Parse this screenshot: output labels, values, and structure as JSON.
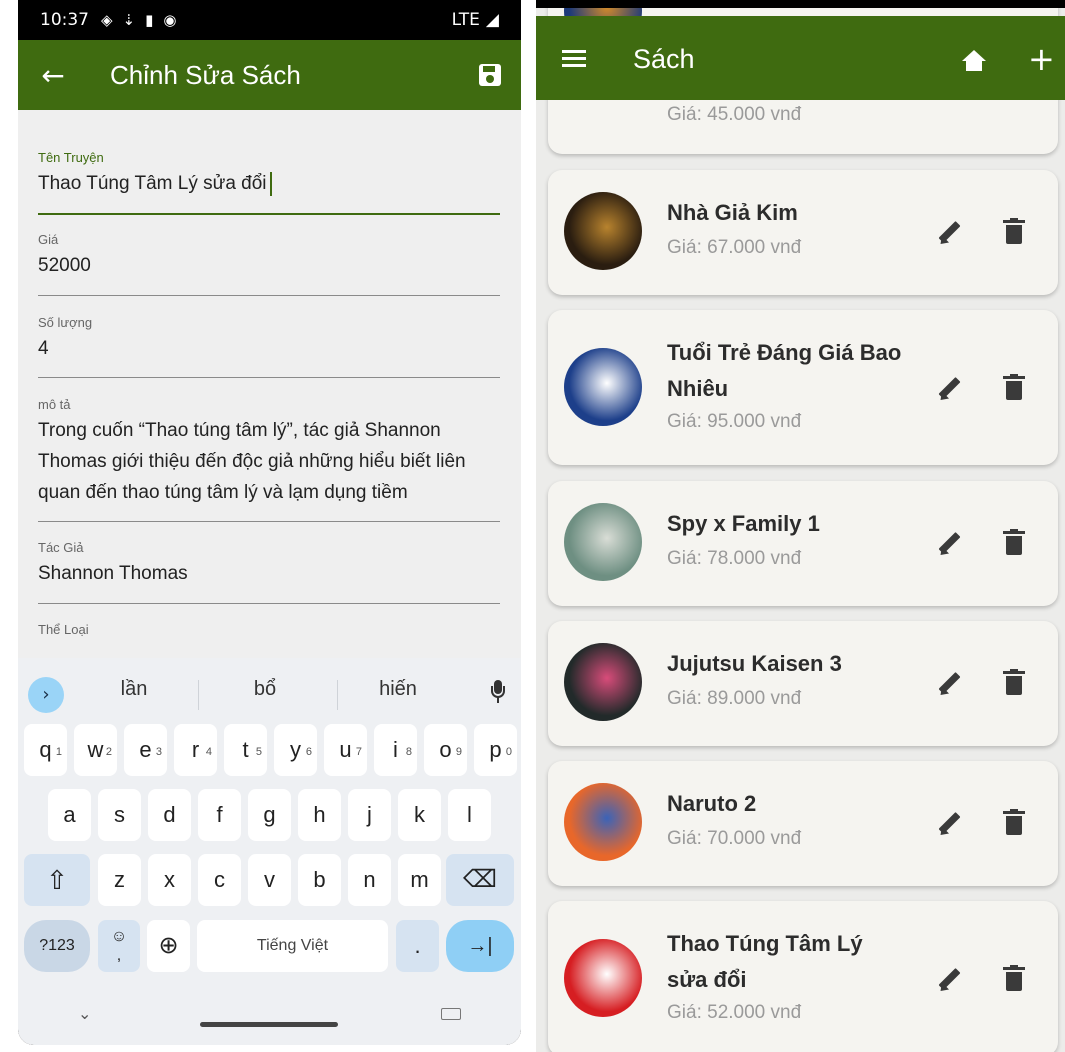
{
  "left_screen": {
    "status": {
      "time": "10:37",
      "network": "LTE"
    },
    "appbar": {
      "title": "Chỉnh Sửa Sách"
    },
    "fields": [
      {
        "label": "Tên Truyện",
        "value": "Thao Túng Tâm Lý sửa đổi"
      },
      {
        "label": "Giá",
        "value": "52000"
      },
      {
        "label": "Số lượng",
        "value": "4"
      },
      {
        "label": "mô tả",
        "value": "Trong cuốn “Thao túng tâm lý”, tác giả Shannon Thomas giới thiệu đến độc giả những hiểu biết liên quan đến thao túng tâm lý và lạm dụng tiềm"
      },
      {
        "label": "Tác Giả",
        "value": "Shannon Thomas"
      },
      {
        "label": "Thể Loại",
        "value": ""
      }
    ],
    "keyboard": {
      "suggestions": [
        "lần",
        "bổ",
        "hiến"
      ],
      "row1": [
        "q",
        "w",
        "e",
        "r",
        "t",
        "y",
        "u",
        "i",
        "o",
        "p"
      ],
      "row1_numbers": [
        "1",
        "2",
        "3",
        "4",
        "5",
        "6",
        "7",
        "8",
        "9",
        "0"
      ],
      "row2": [
        "a",
        "s",
        "d",
        "f",
        "g",
        "h",
        "j",
        "k",
        "l"
      ],
      "row3": [
        "z",
        "x",
        "c",
        "v",
        "b",
        "n",
        "m"
      ],
      "symbols_label": "?123",
      "emoji_label": "☺",
      "comma_label": ",",
      "space_label": "Tiếng Việt",
      "period_label": ".",
      "enter_label": "→|",
      "shift_label": "⇧",
      "backspace_label": "⌫",
      "globe_label": "⊕"
    }
  },
  "right_screen": {
    "appbar": {
      "title": "Sách"
    },
    "books": [
      {
        "name": "",
        "price": "Giá: 45.000 vnđ",
        "cover_colors": [
          "#1d3a7a",
          "#d28a2a"
        ]
      },
      {
        "name": "Nhà Giả Kim",
        "price": "Giá: 67.000 vnđ",
        "cover_colors": [
          "#2a1d10",
          "#b8832e"
        ]
      },
      {
        "name": "Tuổi Trẻ Đáng Giá Bao Nhiêu",
        "price": "Giá: 95.000 vnđ",
        "cover_colors": [
          "#1d3f8a",
          "#ffffff"
        ]
      },
      {
        "name": "Spy x Family 1",
        "price": "Giá: 78.000 vnđ",
        "cover_colors": [
          "#6e8f82",
          "#d9ddd6"
        ]
      },
      {
        "name": "Jujutsu Kaisen 3",
        "price": "Giá: 89.000 vnđ",
        "cover_colors": [
          "#222a2a",
          "#d84c7a"
        ]
      },
      {
        "name": "Naruto 2",
        "price": "Giá: 70.000 vnđ",
        "cover_colors": [
          "#e8672a",
          "#3b63b8"
        ]
      },
      {
        "name": "Thao Túng Tâm Lý sửa đổi",
        "price": "Giá: 52.000 vnđ",
        "cover_colors": [
          "#d61e22",
          "#ffffff"
        ]
      }
    ]
  },
  "colors": {
    "appbar": "#3f6b10",
    "card": "#f5f4f0",
    "accent_keyboard": "#8fcff5"
  }
}
